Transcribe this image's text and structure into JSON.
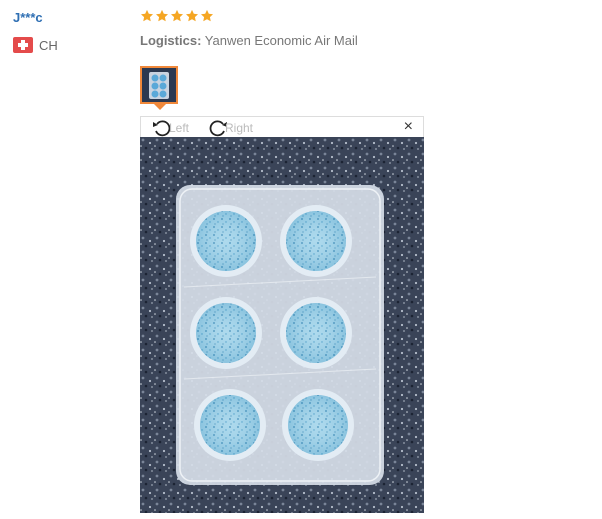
{
  "review": {
    "username": "J***c",
    "country_code": "CH",
    "rating": 5,
    "logistics_label": "Logistics:",
    "logistics_value": "Yanwen Economic Air Mail"
  },
  "viewer": {
    "rotate_left_label": "Left",
    "rotate_right_label": "Right",
    "close_label": "×"
  },
  "colors": {
    "username": "#2f6fb3",
    "star": "#f5a623",
    "thumb_border": "#f0883a"
  },
  "icons": {
    "flag": "switzerland-flag-icon",
    "star": "star-icon",
    "rotate_left": "rotate-left-icon",
    "rotate_right": "rotate-right-icon",
    "close": "close-icon"
  }
}
